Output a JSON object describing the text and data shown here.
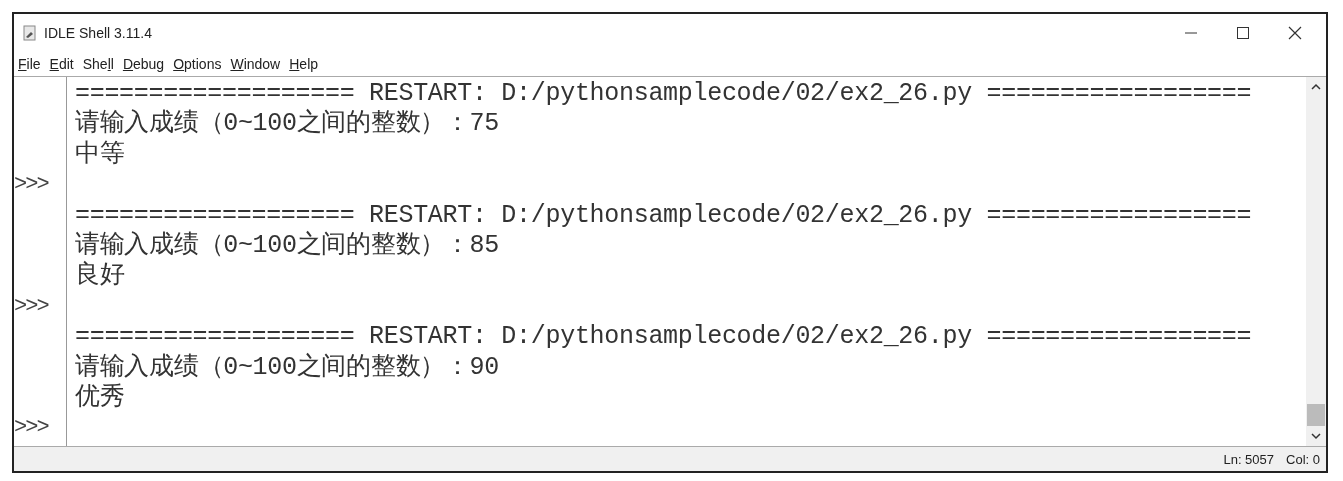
{
  "window": {
    "title": "IDLE Shell 3.11.4"
  },
  "menu": [
    {
      "key": "F",
      "post": "ile"
    },
    {
      "key": "E",
      "post": "dit"
    },
    {
      "pre": "She",
      "key": "l",
      "post": "l"
    },
    {
      "key": "D",
      "post": "ebug"
    },
    {
      "key": "O",
      "post": "ptions"
    },
    {
      "key": "W",
      "post": "indow"
    },
    {
      "key": "H",
      "post": "elp"
    }
  ],
  "shell_rows": [
    {
      "text": "=================== RESTART: D:/pythonsamplecode/02/ex2_26.py =================="
    },
    {
      "text": "请输入成绩（0~100之间的整数）：75"
    },
    {
      "text": "中等"
    },
    {
      "prompt": ">>>"
    },
    {
      "text": "=================== RESTART: D:/pythonsamplecode/02/ex2_26.py =================="
    },
    {
      "text": "请输入成绩（0~100之间的整数）：85"
    },
    {
      "text": "良好"
    },
    {
      "prompt": ">>>"
    },
    {
      "text": "=================== RESTART: D:/pythonsamplecode/02/ex2_26.py =================="
    },
    {
      "text": "请输入成绩（0~100之间的整数）：90"
    },
    {
      "text": "优秀"
    },
    {
      "prompt": ">>>"
    }
  ],
  "status_bar": {
    "line": "Ln: 5057",
    "col": "Col: 0"
  }
}
